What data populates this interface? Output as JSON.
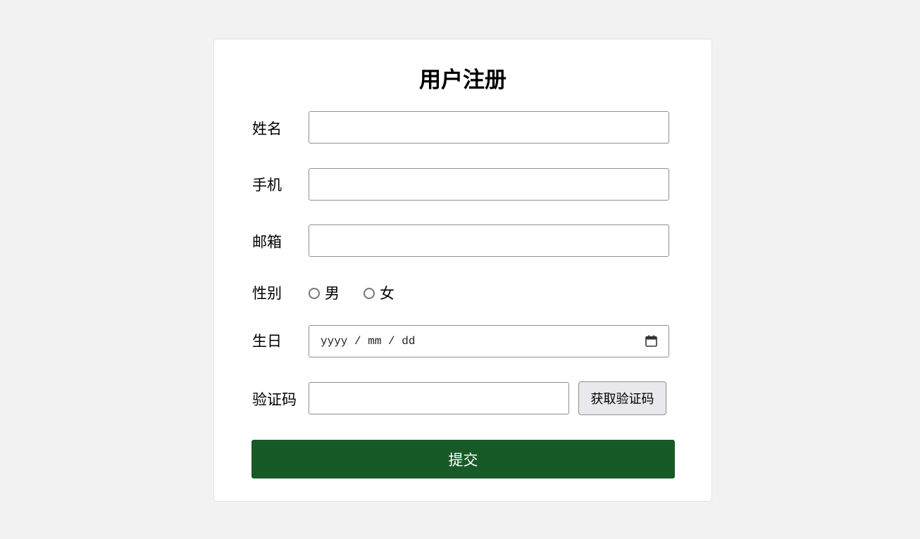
{
  "form": {
    "title": "用户注册",
    "name": {
      "label": "姓名",
      "value": ""
    },
    "phone": {
      "label": "手机",
      "value": ""
    },
    "email": {
      "label": "邮箱",
      "value": ""
    },
    "gender": {
      "label": "性别",
      "options": [
        "男",
        "女"
      ],
      "selected": null
    },
    "birthday": {
      "label": "生日",
      "placeholder": "yyyy / mm / dd"
    },
    "captcha": {
      "label": "验证码",
      "value": "",
      "button_label": "获取验证码"
    },
    "submit_label": "提交"
  },
  "colors": {
    "background": "#f2f2f2",
    "card": "#ffffff",
    "submit_button": "#175a28",
    "submit_text": "#ffffff",
    "secondary_button": "#e9e9ed"
  },
  "icons": {
    "date_picker": "calendar-icon"
  }
}
